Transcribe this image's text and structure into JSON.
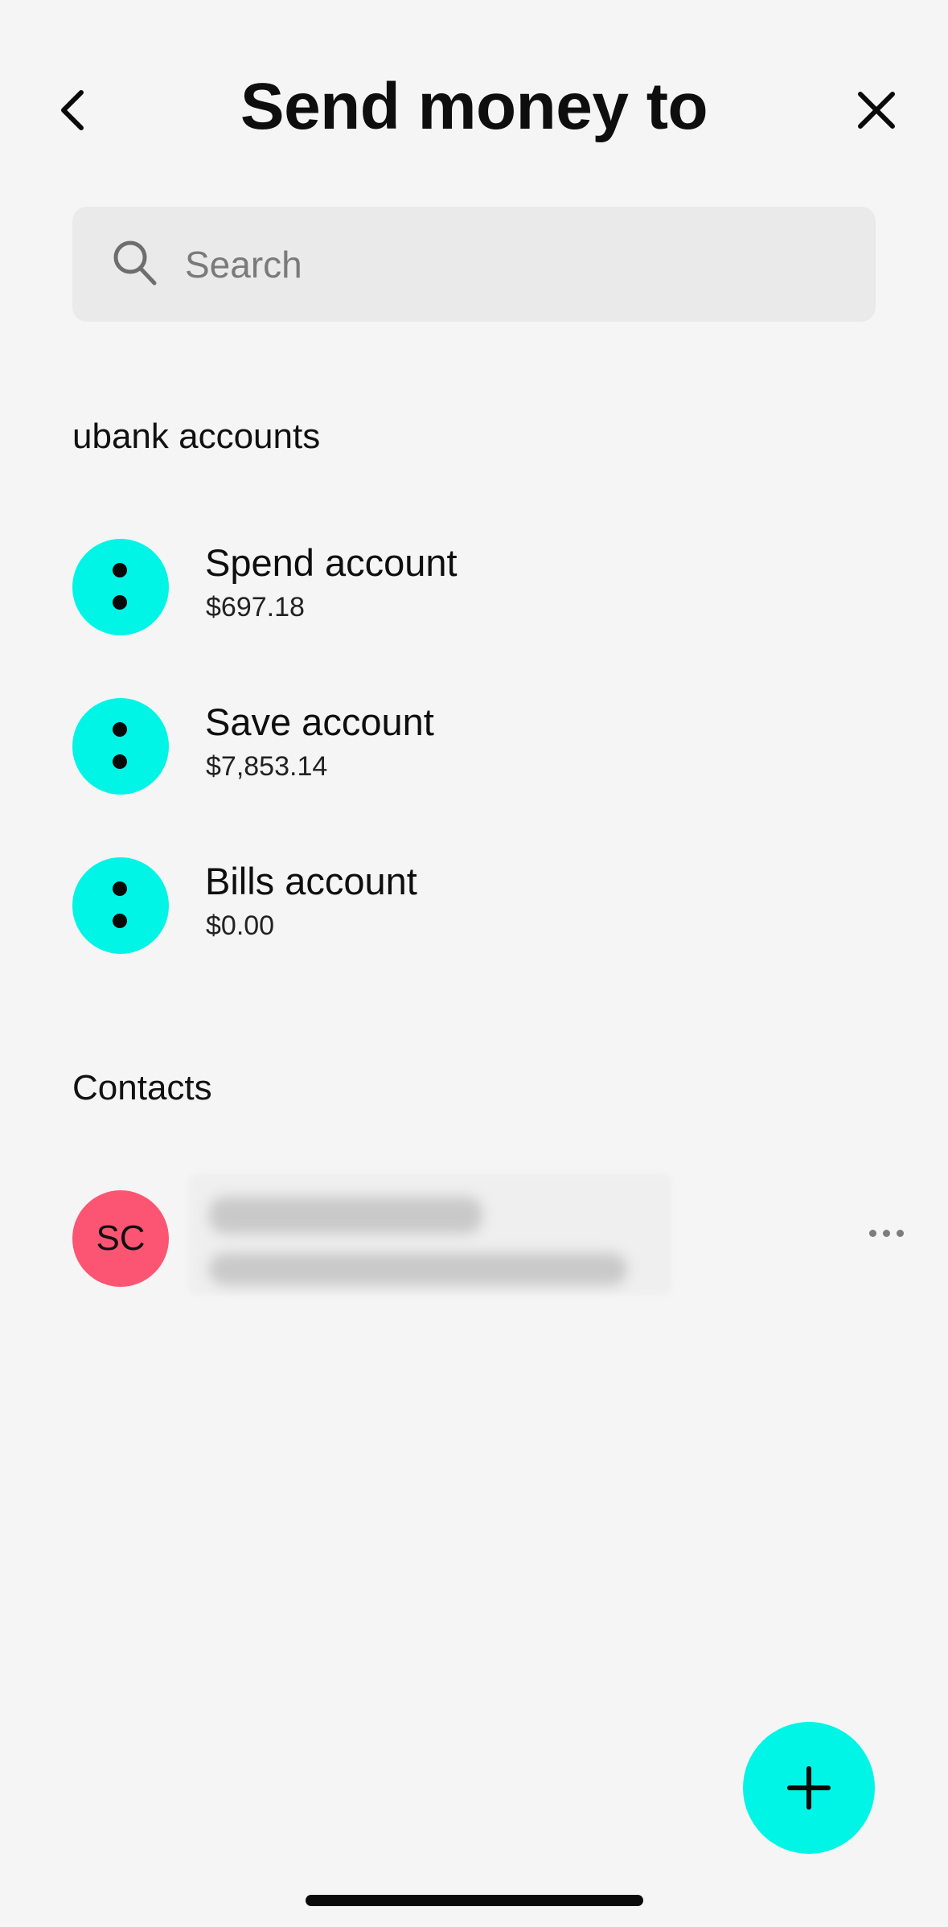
{
  "header": {
    "title": "Send money to",
    "back_icon": "chevron-left-icon",
    "close_icon": "close-icon"
  },
  "search": {
    "placeholder": "Search",
    "value": "",
    "icon": "search-icon"
  },
  "ubank_accounts": {
    "heading": "ubank accounts",
    "items": [
      {
        "name": "Spend account",
        "balance": "$697.18"
      },
      {
        "name": "Save account",
        "balance": "$7,853.14"
      },
      {
        "name": "Bills account",
        "balance": "$0.00"
      }
    ]
  },
  "contacts": {
    "heading": "Contacts",
    "items": [
      {
        "initials": "SC",
        "more_icon": "more-horizontal-icon"
      }
    ]
  },
  "fab": {
    "icon": "plus-icon"
  },
  "colors": {
    "accent": "#00f5e6",
    "contact_avatar": "#fc5573",
    "background": "#f5f5f5",
    "search_bg": "#eaeaea"
  }
}
